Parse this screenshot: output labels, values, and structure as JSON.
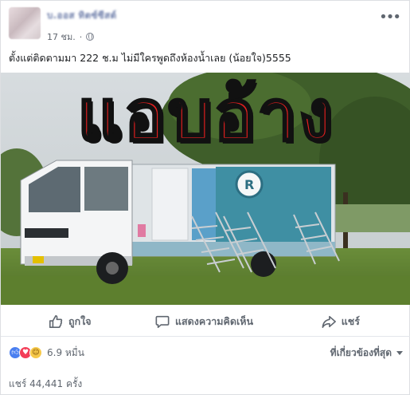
{
  "post": {
    "author_name": "บ.ออส ทิตซ์ซีสต์",
    "timestamp": "17 ชม.",
    "privacy_icon": "globe-icon",
    "caption": "ตั้งแต่ติดตามมา 222 ช.ม ไม่มีใครพูดถึงห้องน้ำเลย (น้อยใจ)5555",
    "image_overlay_text": "แอบอ้าง",
    "colors": {
      "overlay_text": "#e81f1f",
      "link": "#4a7ff0"
    }
  },
  "actions": {
    "like_label": "ถูกใจ",
    "comment_label": "แสดงความคิดเห็น",
    "share_label": "แชร์"
  },
  "stats": {
    "reaction_count": "6.9 หมื่น",
    "reaction_icons": [
      "like-icon",
      "love-icon",
      "haha-icon"
    ],
    "sort_label": "ที่เกี่ยวข้องที่สุด",
    "share_count": "แชร์ 44,441 ครั้ง"
  }
}
